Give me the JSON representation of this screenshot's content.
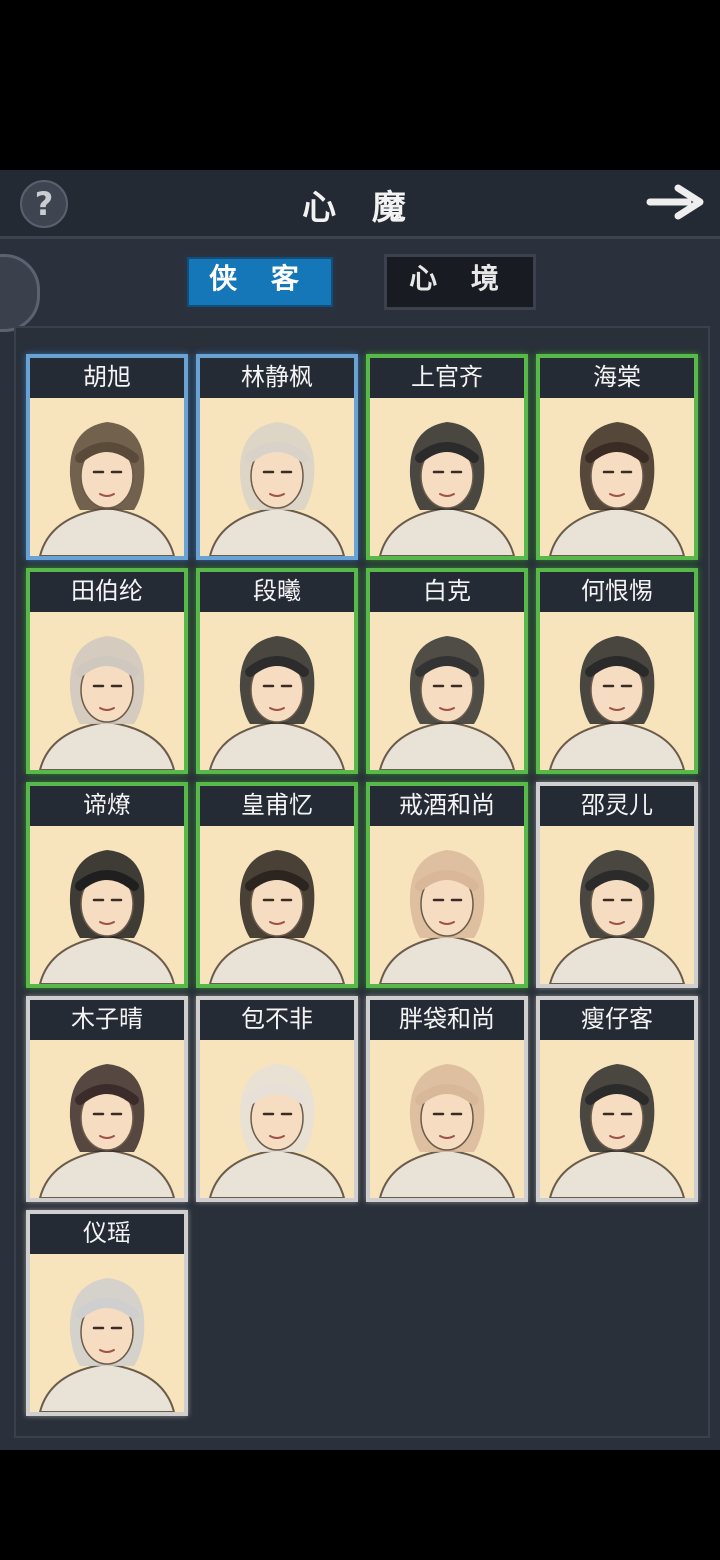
{
  "header": {
    "title": "心 魔",
    "help_icon": "question-icon",
    "next_icon": "arrow-right-icon"
  },
  "tabs": [
    {
      "label": "侠 客",
      "active": true
    },
    {
      "label": "心 境",
      "active": false
    }
  ],
  "heroes": [
    {
      "name": "胡旭",
      "tier": "blue"
    },
    {
      "name": "林静枫",
      "tier": "blue"
    },
    {
      "name": "上官齐",
      "tier": "green"
    },
    {
      "name": "海棠",
      "tier": "green"
    },
    {
      "name": "田伯纶",
      "tier": "green"
    },
    {
      "name": "段曦",
      "tier": "green"
    },
    {
      "name": "白克",
      "tier": "green"
    },
    {
      "name": "何恨惕",
      "tier": "green"
    },
    {
      "name": "谛燎",
      "tier": "green"
    },
    {
      "name": "皇甫忆",
      "tier": "green"
    },
    {
      "name": "戒酒和尚",
      "tier": "green"
    },
    {
      "name": "邵灵儿",
      "tier": "white"
    },
    {
      "name": "木子晴",
      "tier": "white"
    },
    {
      "name": "包不非",
      "tier": "white"
    },
    {
      "name": "胖袋和尚",
      "tier": "white"
    },
    {
      "name": "瘦仔客",
      "tier": "white"
    },
    {
      "name": "仪瑶",
      "tier": "white"
    }
  ],
  "colors": {
    "blue_frame": "#6aa3d3",
    "green_frame": "#58b84a",
    "white_frame": "#cfcfcf",
    "active_tab": "#1576b8"
  }
}
